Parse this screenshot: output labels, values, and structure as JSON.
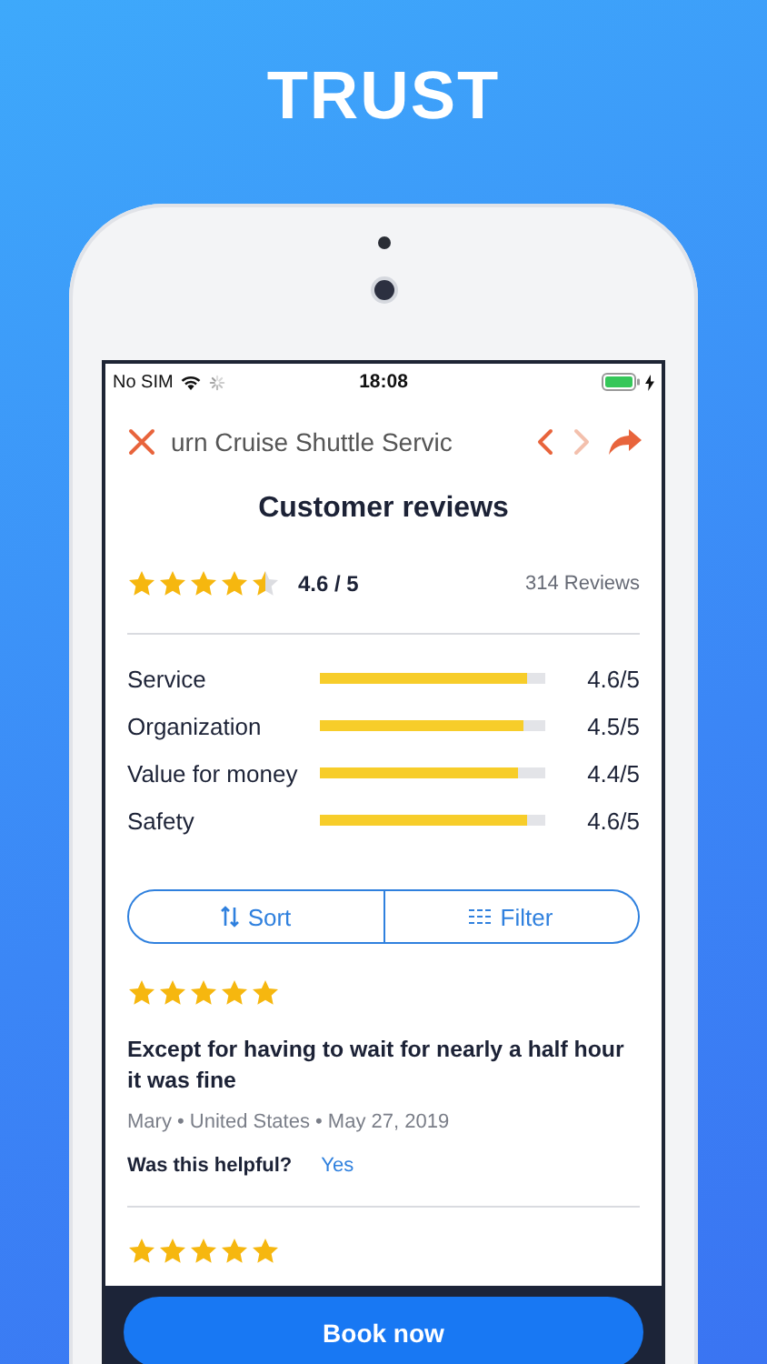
{
  "headline": "TRUST",
  "status_bar": {
    "carrier": "No SIM",
    "time": "18:08"
  },
  "nav": {
    "title": "urn Cruise Shuttle Servic",
    "back_disabled": false,
    "forward_disabled": true
  },
  "heading": "Customer reviews",
  "summary": {
    "stars": 4.5,
    "score": "4.6 / 5",
    "count": "314 Reviews"
  },
  "categories": [
    {
      "name": "Service",
      "level": 0.92,
      "reading": "4.6/5"
    },
    {
      "name": "Organization",
      "level": 0.9,
      "reading": "4.5/5"
    },
    {
      "name": "Value for money",
      "level": 0.88,
      "reading": "4.4/5"
    },
    {
      "name": "Safety",
      "level": 0.92,
      "reading": "4.6/5"
    }
  ],
  "controls": [
    {
      "label": "Sort",
      "kind": "sort"
    },
    {
      "label": "Filter",
      "kind": "filter"
    }
  ],
  "reviews": [
    {
      "stars": 5,
      "title": "Except for having to wait for nearly a half hour it was fine",
      "meta": "Mary • United States • May 27, 2019",
      "helpful_prompt": "Was this helpful?",
      "helpful_answer": "Yes"
    },
    {
      "stars": 5
    }
  ],
  "primary_button": "Book now"
}
